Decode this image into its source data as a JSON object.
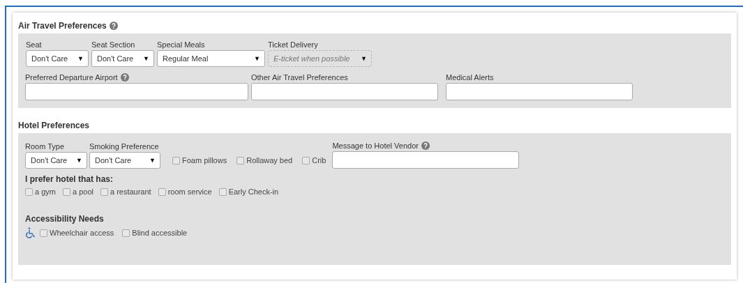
{
  "air": {
    "title": "Air Travel Preferences",
    "help": true,
    "selects": [
      {
        "label": "Seat",
        "value": "Don't Care",
        "caret": "▼",
        "disabled": false
      },
      {
        "label": "Seat Section",
        "value": "Don't Care",
        "caret": "▼",
        "disabled": false
      },
      {
        "label": "Special Meals",
        "value": "Regular Meal",
        "caret": "▼",
        "disabled": false
      },
      {
        "label": "Ticket Delivery",
        "value": "E-ticket when possible",
        "caret": "▼",
        "disabled": true
      }
    ],
    "fields": [
      {
        "label": "Preferred Departure Airport",
        "help": true
      },
      {
        "label": "Other Air Travel Preferences",
        "help": false
      },
      {
        "label": "Medical Alerts",
        "help": false
      }
    ]
  },
  "hotel": {
    "title": "Hotel Preferences",
    "selects": [
      {
        "label": "Room Type",
        "value": "Don't Care",
        "caret": "▼",
        "disabled": false
      },
      {
        "label": "Smoking Preference",
        "value": "Don't Care",
        "caret": "▼",
        "disabled": false
      }
    ],
    "options": [
      {
        "label": "Foam pillows",
        "checked": false
      },
      {
        "label": "Rollaway bed",
        "checked": false
      },
      {
        "label": "Crib",
        "checked": false
      }
    ],
    "message": {
      "label": "Message to Hotel Vendor",
      "help": true
    },
    "amenities_title": "I prefer hotel that has:",
    "amenities": [
      {
        "label": "a gym",
        "checked": false
      },
      {
        "label": "a pool",
        "checked": false
      },
      {
        "label": "a restaurant",
        "checked": false
      },
      {
        "label": "room service",
        "checked": false
      },
      {
        "label": "Early Check-in",
        "checked": false
      }
    ],
    "accessibility_title": "Accessibility Needs",
    "accessibility": [
      {
        "label": "Wheelchair access",
        "checked": false
      },
      {
        "label": "Blind accessible",
        "checked": false
      }
    ]
  }
}
